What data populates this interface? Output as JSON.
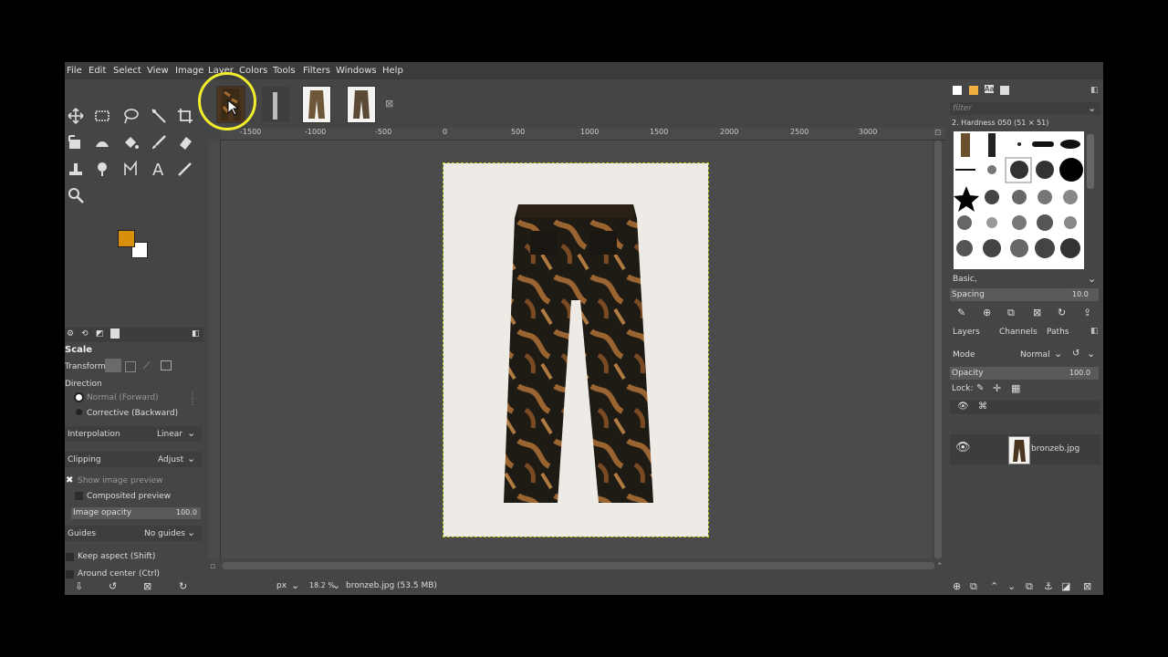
{
  "menu": [
    "File",
    "Edit",
    "Select",
    "View",
    "Image",
    "Layer",
    "Colors",
    "Tools",
    "Filters",
    "Windows",
    "Help"
  ],
  "tool_options": {
    "title": "Scale",
    "transform_label": "Transform:",
    "direction_label": "Direction",
    "direction_normal": "Normal (Forward)",
    "direction_corrective": "Corrective (Backward)",
    "interpolation_label": "Interpolation",
    "interpolation_value": "Linear",
    "clipping_label": "Clipping",
    "clipping_value": "Adjust",
    "show_preview": "Show image preview",
    "composited_preview": "Composited preview",
    "image_opacity_label": "Image opacity",
    "image_opacity_value": "100.0",
    "guides_label": "Guides",
    "guides_value": "No guides",
    "keep_aspect": "Keep aspect (Shift)",
    "around_center": "Around center (Ctrl)"
  },
  "colors": {
    "foreground": "#d8900c",
    "background": "#ffffff",
    "selection": "#f3ee2d"
  },
  "ruler_labels": [
    "-1500",
    "-1000",
    "-500",
    "0",
    "500",
    "1000",
    "1500",
    "2000",
    "2500",
    "3000"
  ],
  "status": {
    "unit": "px",
    "zoom": "18.2 %",
    "file_info": "bronzeb.jpg (53.5 MB)"
  },
  "brushes": {
    "filter_placeholder": "filter",
    "current": "2. Hardness 050 (51 × 51)",
    "set": "Basic,",
    "spacing_label": "Spacing",
    "spacing_value": "10.0"
  },
  "layers_panel": {
    "tabs": [
      "Layers",
      "Channels",
      "Paths"
    ],
    "mode_label": "Mode",
    "mode_value": "Normal",
    "opacity_label": "Opacity",
    "opacity_value": "100.0",
    "lock_label": "Lock:",
    "layer_name": "bronzeb.jpg"
  }
}
